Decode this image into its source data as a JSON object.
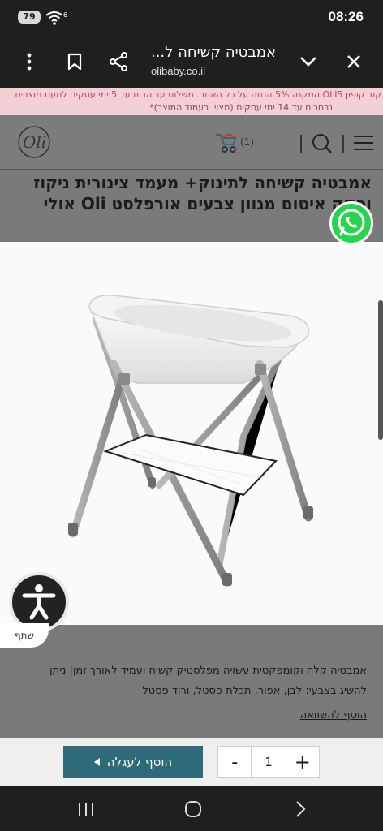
{
  "status": {
    "battery": "79",
    "time": "08:26"
  },
  "browser": {
    "tab_title": "אמבטיה קשיחה ל...",
    "domain": "olibaby.co.il"
  },
  "promo": {
    "line1": "קוד קופון OLI5 המקנה 5% הנחה על כל האתר. משלוח עד הבית עד 5 ימי עסקים למעט מוצרים",
    "line2": "נבחרים עד 14 ימי עסקים (מצוין בעמוד המוצר)*"
  },
  "header": {
    "cart_count": "(1)"
  },
  "product": {
    "title_line1": "אמבטיה קשיחה לתינוק+ מעמד צינורית ניקוז",
    "title_line2": "ופקק איטום מגוון צבעים אורפלסט Oli אולי בייבי",
    "description_line1": "אמבטיה קלה וקומפקטית עשויה מפלסטיק קשיח ועמיד לאורך זמן| ניתן",
    "description_line2": "להשיג בצבעי: לבן, אפור, תכלת פסטל, ורוד פסטל",
    "compare_label": "הוסף להשוואה"
  },
  "share": {
    "label": "שתף"
  },
  "cart_bar": {
    "add_to_cart_label": "הוסף לעגלה",
    "minus_label": "-",
    "quantity": "1",
    "plus_label": "+"
  },
  "colors": {
    "button_accent": "#2e6b79",
    "promo_background": "#f3cfd6",
    "promo_text": "#d33b64",
    "whatsapp": "#2ad34f"
  },
  "icons": [
    "battery-icon",
    "wifi-icon",
    "more-vert-icon",
    "bookmark-icon",
    "share-icon",
    "chevron-down-icon",
    "close-icon",
    "logo",
    "stroller-cart-icon",
    "search-icon",
    "hamburger-menu-icon",
    "whatsapp-icon",
    "accessibility-icon",
    "recents-icon",
    "home-icon",
    "back-icon"
  ]
}
